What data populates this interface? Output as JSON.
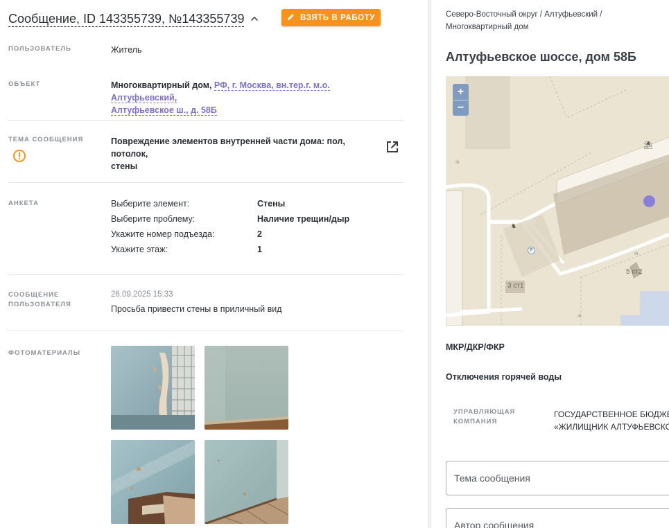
{
  "header": {
    "title": "Сообщение, ID 143355739, №143355739",
    "take_button": "ВЗЯТЬ В РАБОТУ"
  },
  "user": {
    "label": "ПОЛЬЗОВАТЕЛЬ",
    "value": "Житель"
  },
  "object": {
    "label": "ОБЪЕКТ",
    "type": "Многоквартирный дом,",
    "address_line1": "РФ, г. Москва, вн.тер.г. м.о. Алтуфьевский,",
    "address_line2": "Алтуфьевское ш., д. 58Б"
  },
  "topic": {
    "label": "ТЕМА СООБЩЕНИЯ",
    "line1": "Повреждение элементов внутренней части дома: пол, потолок,",
    "line2": "стены"
  },
  "survey": {
    "label": "АНКЕТА",
    "rows": [
      {
        "q": "Выберите элемент:",
        "a": "Стены"
      },
      {
        "q": "Выберите проблему:",
        "a": "Наличие трещин/дыр"
      },
      {
        "q": "Укажите номер подъезда:",
        "a": "2"
      },
      {
        "q": "Укажите этаж:",
        "a": "1"
      }
    ]
  },
  "message": {
    "label_line1": "СООБЩЕНИЕ",
    "label_line2": "ПОЛЬЗОВАТЕЛЯ",
    "date": "26.09.2025 15:33",
    "text": "Просьба привести стены в приличный вид"
  },
  "photos": {
    "label": "ФОТОМАТЕРИАЛЫ",
    "count": 4
  },
  "right": {
    "breadcrumb_line1": "Северо-Восточный округ / Алтуфьевский /",
    "breadcrumb_line2": "Многоквартирный дом",
    "address_title": "Алтуфьевское шоссе, дом 58Б",
    "map": {
      "zoom_in": "+",
      "zoom_out": "−",
      "label_building1": "3 ст1",
      "label_building2": "5 ст2",
      "parking": "P"
    },
    "program": "МКР/ДКР/ФКР",
    "hot_water": "Отключения горячей воды",
    "management": {
      "label_line1": "УПРАВЛЯЮЩАЯ",
      "label_line2": "КОМПАНИЯ",
      "value_line1": "ГОСУДАРСТВЕННОЕ БЮДЖЕ",
      "value_line2": "«ЖИЛИЩНИК АЛТУФЬЕВСКО"
    },
    "fields": {
      "topic_placeholder": "Тема сообщения",
      "author_placeholder": "Автор сообщения"
    }
  },
  "colors": {
    "accent": "#f7921e",
    "link": "#7d71c9",
    "warning": "#f7921e",
    "map_marker": "#8a7fd6",
    "zoom_button": "#7f9bc0"
  },
  "icons": [
    "chevron-up-icon",
    "pencil-icon",
    "warning-circle-icon",
    "external-link-icon",
    "map-marker-icon"
  ]
}
